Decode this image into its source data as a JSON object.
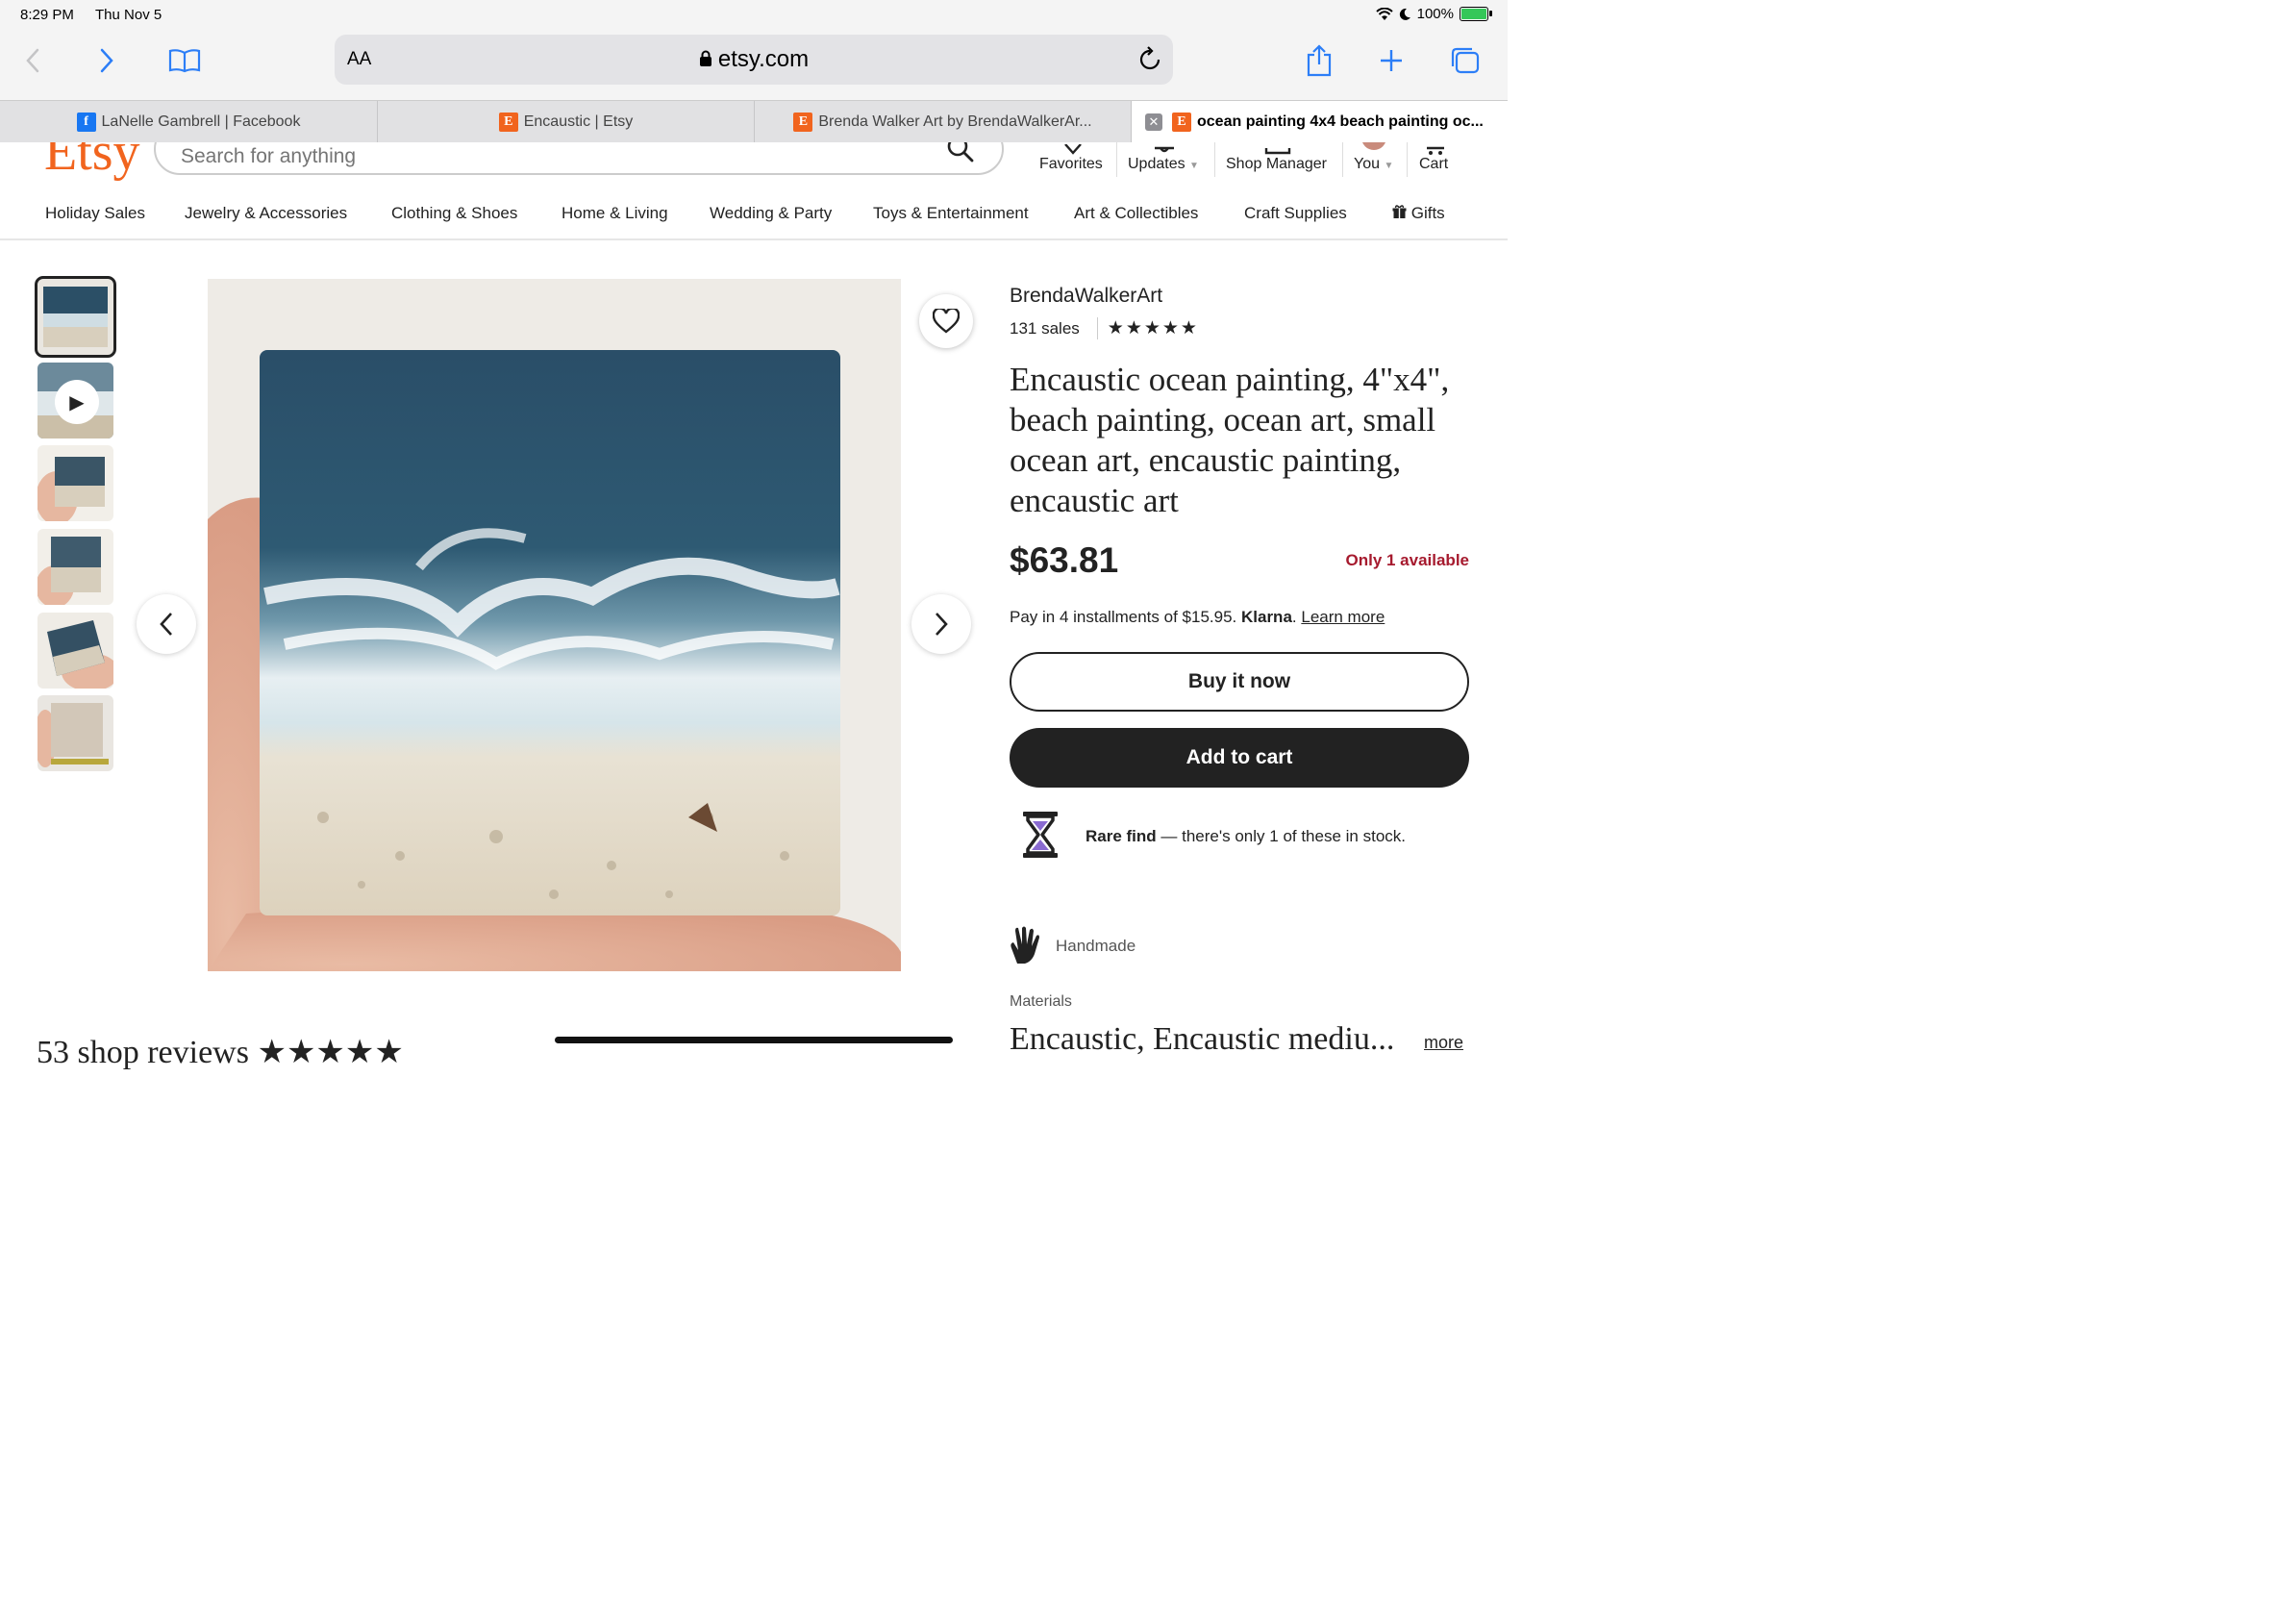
{
  "status": {
    "time": "8:29 PM",
    "date": "Thu Nov 5",
    "battery": "100%"
  },
  "toolbar": {
    "text_size_label": "AA",
    "url": "etsy.com"
  },
  "tabs": [
    {
      "title": "LaNelle Gambrell | Facebook",
      "favicon": "f"
    },
    {
      "title": "Encaustic | Etsy",
      "favicon": "E"
    },
    {
      "title": "Brenda Walker Art by BrendaWalkerAr...",
      "favicon": "E"
    },
    {
      "title": "ocean painting 4x4 beach painting oc...",
      "favicon": "E",
      "active": true
    }
  ],
  "header": {
    "logo": "Etsy",
    "search_placeholder": "Search for anything",
    "nav": {
      "favorites": "Favorites",
      "updates": "Updates",
      "shop_manager": "Shop Manager",
      "you": "You",
      "cart": "Cart"
    }
  },
  "categories": [
    "Holiday Sales",
    "Jewelry & Accessories",
    "Clothing & Shoes",
    "Home & Living",
    "Wedding & Party",
    "Toys & Entertainment",
    "Art & Collectibles",
    "Craft Supplies",
    "Gifts"
  ],
  "listing": {
    "shop_name": "BrendaWalkerArt",
    "sales": "131 sales",
    "rating_stars": "★★★★★",
    "title": "Encaustic ocean painting, 4\"x4\", beach painting, ocean art, small ocean art, encaustic painting, encaustic art",
    "price": "$63.81",
    "availability": "Only 1 available",
    "installments_text": "Pay in 4 installments of $15.95.",
    "klarna": "Klarna",
    "learn_more": "Learn more",
    "buy_now": "Buy it now",
    "add_to_cart": "Add to cart",
    "rare_find_bold": "Rare find",
    "rare_find_text": " — there's only 1 of these in stock.",
    "handmade": "Handmade",
    "materials_label": "Materials",
    "materials_value": "Encaustic, Encaustic mediu...",
    "more": "more"
  },
  "reviews_heading": "53 shop reviews ★★★★★",
  "colors": {
    "etsy_orange": "#f1641e",
    "safari_blue": "#2c7ef7",
    "availability_red": "#a61a2e",
    "dark": "#222222"
  }
}
